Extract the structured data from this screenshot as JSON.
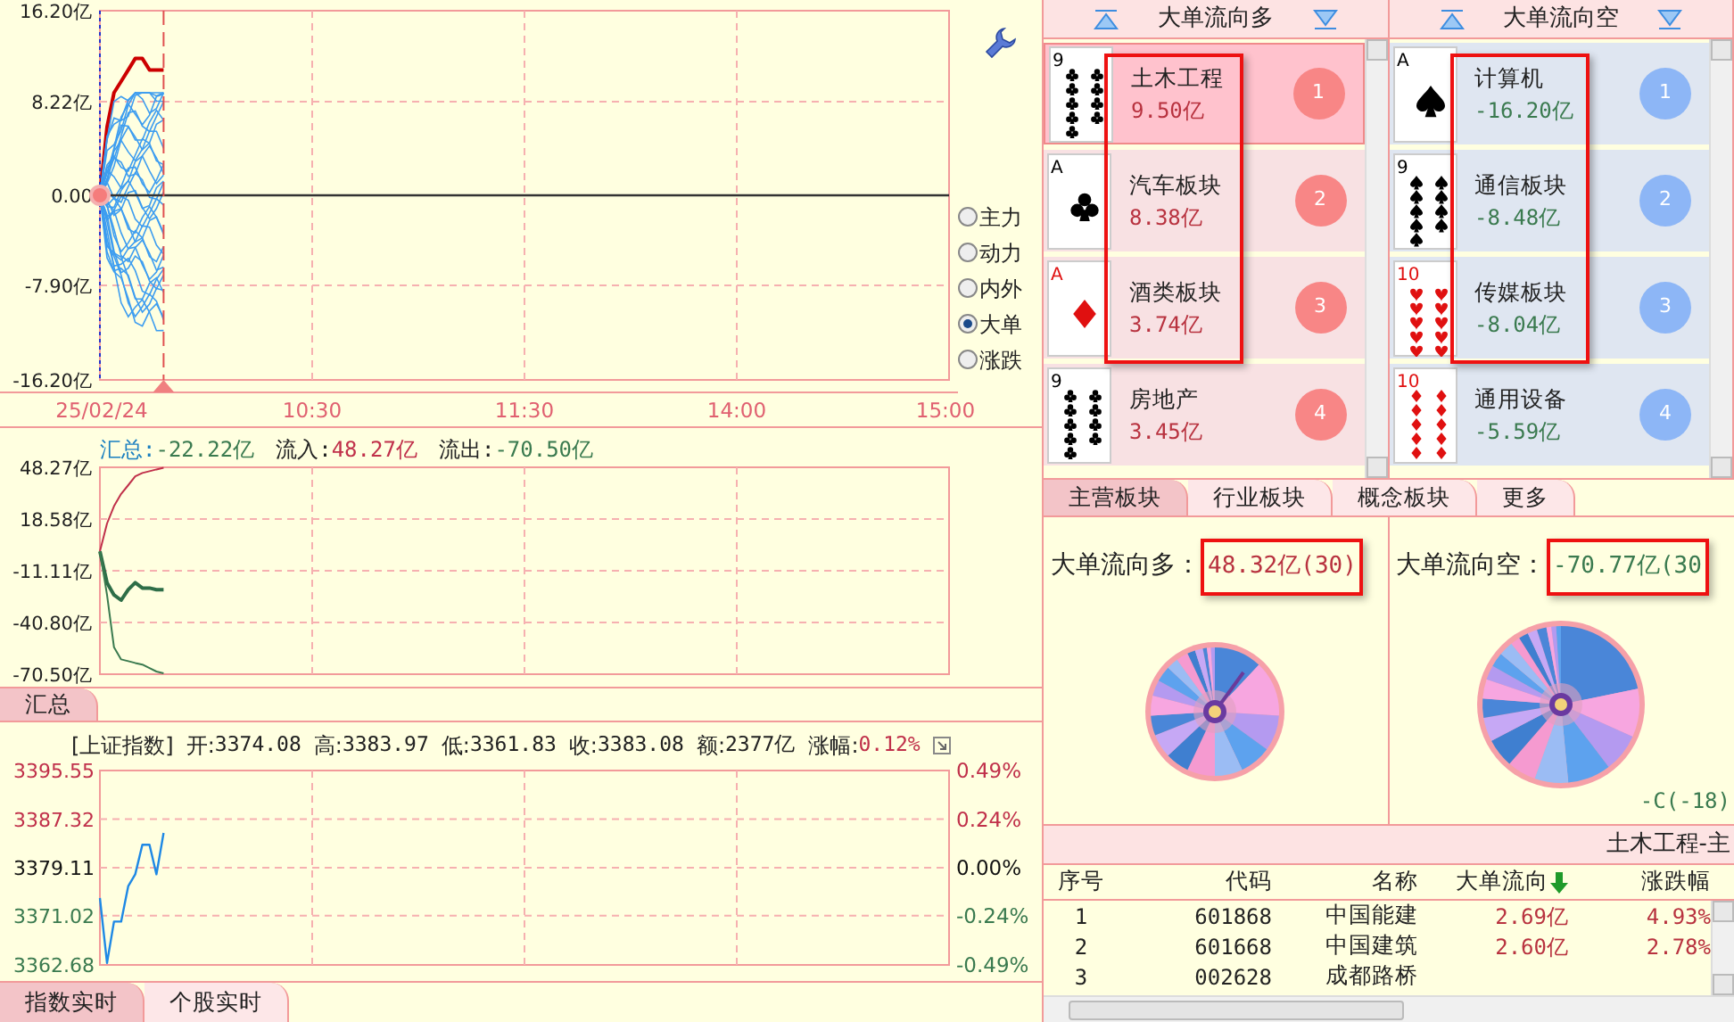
{
  "top_chart": {
    "chart_data": {
      "type": "line",
      "grid": true,
      "ylim": [
        -16.2,
        16.2
      ],
      "categories": [
        "25/02/24",
        null,
        null,
        null,
        null,
        null,
        null,
        null,
        null,
        null,
        null,
        null,
        null,
        null,
        null,
        null,
        null,
        null,
        null,
        null,
        null,
        null,
        null,
        null,
        null,
        null,
        null,
        null,
        null,
        null,
        "10:30",
        null,
        null,
        null,
        null,
        null,
        null,
        null,
        null,
        null,
        null,
        null,
        null,
        null,
        null,
        null,
        null,
        null,
        null,
        null,
        null,
        null,
        null,
        null,
        null,
        null,
        null,
        null,
        null,
        null,
        "11:30",
        null,
        null,
        null,
        null,
        null,
        null,
        null,
        null,
        null,
        null,
        null,
        null,
        null,
        null,
        null,
        null,
        null,
        null,
        null,
        null,
        null,
        null,
        null,
        null,
        null,
        null,
        null,
        null,
        null,
        "14:00",
        null,
        null,
        null,
        null,
        null,
        null,
        null,
        null,
        null,
        null,
        null,
        null,
        null,
        null,
        null,
        null,
        null,
        null,
        null,
        null,
        null,
        null,
        null,
        null,
        null,
        null,
        null,
        null,
        null,
        "15:00"
      ],
      "yticks": [
        {
          "value": 16.2,
          "label": "16.20亿"
        },
        {
          "value": 8.22,
          "label": "8.22亿"
        },
        {
          "value": 0,
          "label": "0.00"
        },
        {
          "value": -7.9,
          "label": "-7.90亿"
        },
        {
          "value": -16.2,
          "label": "-16.20亿"
        }
      ],
      "series": [
        {
          "color": "#cc0000",
          "values": [
            0,
            6,
            9,
            10,
            11,
            12,
            12,
            11,
            11,
            11,
            null,
            null,
            null,
            null,
            null,
            null,
            null,
            null,
            null,
            null,
            null,
            null,
            null,
            null,
            null,
            null,
            null,
            null,
            null,
            null,
            null,
            null,
            null,
            null,
            null,
            null,
            null,
            null,
            null,
            null,
            null,
            null,
            null,
            null,
            null,
            null,
            null,
            null,
            null,
            null,
            null,
            null,
            null,
            null,
            null,
            null,
            null,
            null,
            null,
            null,
            null,
            null,
            null,
            null,
            null,
            null,
            null,
            null,
            null,
            null,
            null,
            null,
            null,
            null,
            null,
            null,
            null,
            null,
            null,
            null,
            null,
            null,
            null,
            null,
            null,
            null,
            null,
            null,
            null,
            null,
            null,
            null,
            null,
            null,
            null,
            null,
            null,
            null,
            null,
            null,
            null,
            null,
            null,
            null,
            null,
            null,
            null,
            null,
            null,
            null,
            null,
            null,
            null,
            null,
            null,
            null,
            null,
            null,
            null,
            null,
            null
          ]
        }
      ]
    },
    "options": [
      {
        "label": "主力",
        "selected": false
      },
      {
        "label": "动力",
        "selected": false
      },
      {
        "label": "内外",
        "selected": false
      },
      {
        "label": "大单",
        "selected": true
      },
      {
        "label": "涨跌",
        "selected": false
      }
    ]
  },
  "flow_chart": {
    "summary": [
      {
        "text": "汇总:",
        "color": "#1a7fc0"
      },
      {
        "text": "-22.22亿",
        "color": "#3a7a4f"
      },
      {
        "text": "流入:",
        "color": "#222222"
      },
      {
        "text": "48.27亿",
        "color": "#c0304a"
      },
      {
        "text": "流出:",
        "color": "#222222"
      },
      {
        "text": "-70.50亿",
        "color": "#3a7a4f"
      }
    ],
    "chart_data": {
      "type": "line",
      "grid": true,
      "ylim": [
        -70.5,
        48.27
      ],
      "categories": [
        null,
        null,
        null,
        null,
        null,
        null,
        null,
        null,
        null,
        null,
        null,
        null,
        null,
        null,
        null,
        null,
        null,
        null,
        null,
        null,
        null,
        null,
        null,
        null,
        null,
        null,
        null,
        null,
        null,
        null,
        null,
        null,
        null,
        null,
        null,
        null,
        null,
        null,
        null,
        null,
        null,
        null,
        null,
        null,
        null,
        null,
        null,
        null,
        null,
        null,
        null,
        null,
        null,
        null,
        null,
        null,
        null,
        null,
        null,
        null,
        null,
        null,
        null,
        null,
        null,
        null,
        null,
        null,
        null,
        null,
        null,
        null,
        null,
        null,
        null,
        null,
        null,
        null,
        null,
        null,
        null,
        null,
        null,
        null,
        null,
        null,
        null,
        null,
        null,
        null,
        null,
        null,
        null,
        null,
        null,
        null,
        null,
        null,
        null,
        null,
        null,
        null,
        null,
        null,
        null,
        null,
        null,
        null,
        null,
        null,
        null,
        null,
        null,
        null,
        null,
        null,
        null,
        null,
        null,
        null,
        null
      ],
      "yticks": [
        {
          "value": 48.27,
          "label": "48.27亿"
        },
        {
          "value": 18.58,
          "label": "18.58亿"
        },
        {
          "value": -11.11,
          "label": "-11.11亿"
        },
        {
          "value": -40.8,
          "label": "-40.80亿"
        },
        {
          "value": -70.5,
          "label": "-70.50亿"
        }
      ],
      "series": [
        {
          "color": "#c0304a",
          "values": [
            0,
            16,
            26,
            33,
            38,
            43,
            45,
            46,
            47,
            48,
            null,
            null,
            null,
            null,
            null,
            null,
            null,
            null,
            null,
            null,
            null,
            null,
            null,
            null,
            null,
            null,
            null,
            null,
            null,
            null,
            null,
            null,
            null,
            null,
            null,
            null,
            null,
            null,
            null,
            null,
            null,
            null,
            null,
            null,
            null,
            null,
            null,
            null,
            null,
            null,
            null,
            null,
            null,
            null,
            null,
            null,
            null,
            null,
            null,
            null,
            null,
            null,
            null,
            null,
            null,
            null,
            null,
            null,
            null,
            null,
            null,
            null,
            null,
            null,
            null,
            null,
            null,
            null,
            null,
            null,
            null,
            null,
            null,
            null,
            null,
            null,
            null,
            null,
            null,
            null,
            null,
            null,
            null,
            null,
            null,
            null,
            null,
            null,
            null,
            null,
            null,
            null,
            null,
            null,
            null,
            null,
            null,
            null,
            null,
            null,
            null,
            null,
            null,
            null,
            null,
            null,
            null,
            null,
            null,
            null,
            null
          ]
        },
        {
          "color": "#2e6e48",
          "values": [
            0,
            -18,
            -25,
            -28,
            -22,
            -18,
            -21,
            -21,
            -22,
            -22,
            null,
            null,
            null,
            null,
            null,
            null,
            null,
            null,
            null,
            null,
            null,
            null,
            null,
            null,
            null,
            null,
            null,
            null,
            null,
            null,
            null,
            null,
            null,
            null,
            null,
            null,
            null,
            null,
            null,
            null,
            null,
            null,
            null,
            null,
            null,
            null,
            null,
            null,
            null,
            null,
            null,
            null,
            null,
            null,
            null,
            null,
            null,
            null,
            null,
            null,
            null,
            null,
            null,
            null,
            null,
            null,
            null,
            null,
            null,
            null,
            null,
            null,
            null,
            null,
            null,
            null,
            null,
            null,
            null,
            null,
            null,
            null,
            null,
            null,
            null,
            null,
            null,
            null,
            null,
            null,
            null,
            null,
            null,
            null,
            null,
            null,
            null,
            null,
            null,
            null,
            null,
            null,
            null,
            null,
            null,
            null,
            null,
            null,
            null,
            null,
            null,
            null,
            null,
            null,
            null,
            null,
            null,
            null,
            null,
            null,
            null
          ]
        },
        {
          "color": "#3a7a4f",
          "values": [
            0,
            -25,
            -55,
            -62,
            -63,
            -64,
            -65,
            -67,
            -69,
            -70,
            null,
            null,
            null,
            null,
            null,
            null,
            null,
            null,
            null,
            null,
            null,
            null,
            null,
            null,
            null,
            null,
            null,
            null,
            null,
            null,
            null,
            null,
            null,
            null,
            null,
            null,
            null,
            null,
            null,
            null,
            null,
            null,
            null,
            null,
            null,
            null,
            null,
            null,
            null,
            null,
            null,
            null,
            null,
            null,
            null,
            null,
            null,
            null,
            null,
            null,
            null,
            null,
            null,
            null,
            null,
            null,
            null,
            null,
            null,
            null,
            null,
            null,
            null,
            null,
            null,
            null,
            null,
            null,
            null,
            null,
            null,
            null,
            null,
            null,
            null,
            null,
            null,
            null,
            null,
            null,
            null,
            null,
            null,
            null,
            null,
            null,
            null,
            null,
            null,
            null,
            null,
            null,
            null,
            null,
            null,
            null,
            null,
            null,
            null,
            null,
            null,
            null,
            null,
            null,
            null,
            null,
            null,
            null,
            null,
            null,
            null
          ]
        }
      ]
    }
  },
  "flow_tabs": [
    {
      "label": "汇总",
      "selected": true
    }
  ],
  "index_chart": {
    "name": "[上证指数]",
    "fields": [
      {
        "label": "开:",
        "value": "3374.08",
        "color": "#222222"
      },
      {
        "label": "高:",
        "value": "3383.97",
        "color": "#222222"
      },
      {
        "label": "低:",
        "value": "3361.83",
        "color": "#222222"
      },
      {
        "label": "收:",
        "value": "3383.08",
        "color": "#222222"
      },
      {
        "label": "额:",
        "value": "2377亿",
        "color": "#222222"
      },
      {
        "label": "涨幅:",
        "value": "0.12%",
        "color": "#c0304a"
      }
    ],
    "chart_data": {
      "type": "line",
      "grid": true,
      "ylim": [
        3362.68,
        3395.55
      ],
      "categories": [
        null,
        null,
        null,
        null,
        null,
        null,
        null,
        null,
        null,
        null,
        null,
        null,
        null,
        null,
        null,
        null,
        null,
        null,
        null,
        null,
        null,
        null,
        null,
        null,
        null,
        null,
        null,
        null,
        null,
        null,
        null,
        null,
        null,
        null,
        null,
        null,
        null,
        null,
        null,
        null,
        null,
        null,
        null,
        null,
        null,
        null,
        null,
        null,
        null,
        null,
        null,
        null,
        null,
        null,
        null,
        null,
        null,
        null,
        null,
        null,
        null,
        null,
        null,
        null,
        null,
        null,
        null,
        null,
        null,
        null,
        null,
        null,
        null,
        null,
        null,
        null,
        null,
        null,
        null,
        null,
        null,
        null,
        null,
        null,
        null,
        null,
        null,
        null,
        null,
        null,
        null,
        null,
        null,
        null,
        null,
        null,
        null,
        null,
        null,
        null,
        null,
        null,
        null,
        null,
        null,
        null,
        null,
        null,
        null,
        null,
        null,
        null,
        null,
        null,
        null,
        null,
        null,
        null,
        null,
        null,
        null
      ],
      "yticks": [
        {
          "value": 3395.55,
          "label": "3395.55"
        },
        {
          "value": 3387.32,
          "label": "3387.32"
        },
        {
          "value": 3379.11,
          "label": "3379.11"
        },
        {
          "value": 3371.02,
          "label": "3371.02"
        },
        {
          "value": 3362.68,
          "label": "3362.68"
        }
      ],
      "series": [
        {
          "color": "#1e88e5",
          "values": [
            3374,
            3363,
            3370,
            3370,
            3376,
            3378,
            3383,
            3383,
            3378,
            3385,
            null,
            null,
            null,
            null,
            null,
            null,
            null,
            null,
            null,
            null,
            null,
            null,
            null,
            null,
            null,
            null,
            null,
            null,
            null,
            null,
            null,
            null,
            null,
            null,
            null,
            null,
            null,
            null,
            null,
            null,
            null,
            null,
            null,
            null,
            null,
            null,
            null,
            null,
            null,
            null,
            null,
            null,
            null,
            null,
            null,
            null,
            null,
            null,
            null,
            null,
            null,
            null,
            null,
            null,
            null,
            null,
            null,
            null,
            null,
            null,
            null,
            null,
            null,
            null,
            null,
            null,
            null,
            null,
            null,
            null,
            null,
            null,
            null,
            null,
            null,
            null,
            null,
            null,
            null,
            null,
            null,
            null,
            null,
            null,
            null,
            null,
            null,
            null,
            null,
            null,
            null,
            null,
            null,
            null,
            null,
            null,
            null,
            null,
            null,
            null,
            null,
            null,
            null,
            null,
            null,
            null,
            null,
            null,
            null,
            null,
            null
          ]
        }
      ]
    },
    "right_labels": [
      "0.49%",
      "0.24%",
      "0.00%",
      "-0.24%",
      "-0.49%"
    ]
  },
  "bottom_tabs": [
    {
      "label": "指数实时",
      "selected": true
    },
    {
      "label": "个股实时",
      "selected": false
    }
  ],
  "boards": [
    {
      "title": "大单流向多",
      "kind": "inflow",
      "items": [
        {
          "name": "土木工程",
          "value": "9.50亿",
          "rank": "1",
          "selected": true,
          "highlight": true,
          "card": {
            "rank": "9",
            "kind": "club"
          }
        },
        {
          "name": "汽车板块",
          "value": "8.38亿",
          "rank": "2",
          "selected": false,
          "highlight": true,
          "card": {
            "rank": "A",
            "kind": "club"
          }
        },
        {
          "name": "酒类板块",
          "value": "3.74亿",
          "rank": "3",
          "selected": false,
          "highlight": true,
          "card": {
            "rank": "A",
            "kind": "diamond"
          }
        },
        {
          "name": "房地产",
          "value": "3.45亿",
          "rank": "4",
          "selected": false,
          "highlight": false,
          "card": {
            "rank": "9",
            "kind": "club"
          }
        }
      ]
    },
    {
      "title": "大单流向空",
      "kind": "outflow",
      "items": [
        {
          "name": "计算机",
          "value": "-16.20亿",
          "rank": "1",
          "selected": false,
          "highlight": true,
          "card": {
            "rank": "A",
            "kind": "spade"
          }
        },
        {
          "name": "通信板块",
          "value": "-8.48亿",
          "rank": "2",
          "selected": false,
          "highlight": true,
          "card": {
            "rank": "9",
            "kind": "spade"
          }
        },
        {
          "name": "传媒板块",
          "value": "-8.04亿",
          "rank": "3",
          "selected": false,
          "highlight": true,
          "card": {
            "rank": "10",
            "kind": "heart"
          }
        },
        {
          "name": "通用设备",
          "value": "-5.59亿",
          "rank": "4",
          "selected": false,
          "highlight": false,
          "card": {
            "rank": "10",
            "kind": "diamond"
          }
        }
      ]
    }
  ],
  "board_tabs": [
    {
      "label": "主营板块",
      "selected": true
    },
    {
      "label": "行业板块",
      "selected": false
    },
    {
      "label": "概念板块",
      "selected": false
    },
    {
      "label": "更多",
      "selected": false
    }
  ],
  "totals": [
    {
      "label": "大单流向多：",
      "value": "48.32亿(30)",
      "kind": "inflow",
      "highlight": true
    },
    {
      "label": "大单流向空：",
      "value": "-70.77亿(30",
      "kind": "outflow",
      "highlight": true
    }
  ],
  "bottom_note": "-C(-18)",
  "stock_table": {
    "title": "土木工程-主",
    "columns": [
      {
        "label": "序号",
        "kind": "text",
        "sorted": false
      },
      {
        "label": "代码",
        "kind": "text",
        "sorted": false
      },
      {
        "label": "名称",
        "kind": "text",
        "sorted": false
      },
      {
        "label": "大单流向",
        "kind": "value",
        "sorted": true
      },
      {
        "label": "涨跌幅",
        "kind": "value",
        "sorted": false
      }
    ],
    "rows": [
      [
        "1",
        "601868",
        "中国能建",
        "2.69亿",
        "4.93%"
      ],
      [
        "2",
        "601668",
        "中国建筑",
        "2.60亿",
        "2.78%"
      ],
      [
        "3",
        "002628",
        "成都路桥"
      ]
    ]
  }
}
